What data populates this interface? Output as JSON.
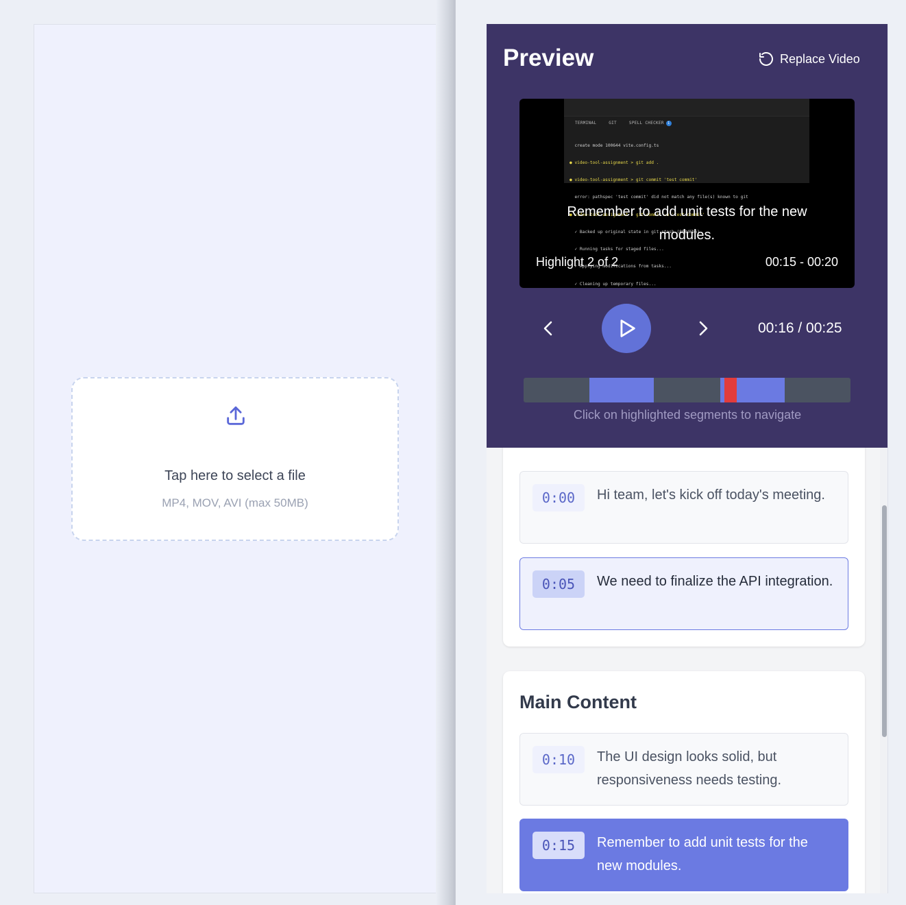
{
  "upload": {
    "title": "Tap here to select a file",
    "subtitle": "MP4, MOV, AVI (max 50MB)",
    "icon": "upload-icon"
  },
  "preview": {
    "title": "Preview",
    "replace_label": "Replace Video",
    "video": {
      "terminal_tabs": [
        "TERMINAL",
        "GIT",
        "SPELL CHECKER"
      ],
      "terminal_badge": "1",
      "terminal_lines": [
        "  create mode 100644 vite.config.ts",
        "● video-tool-assignment > git add .",
        "● video-tool-assignment > git commit 'test commit'",
        "  error: pathspec 'test commit' did not match any file(s) known to git",
        "● video-tool-assignment > git commit -m 'test commit'",
        "  ✓ Backed up original state in git stash (808d6b6)",
        "  ✓ Running tasks for staged files...",
        "  ✓ Applying modifications from tasks...",
        "  ✓ Cleaning up temporary files..."
      ],
      "caption": "Remember to add unit tests for the new modules.",
      "highlight_label": "Highlight 2 of 2",
      "highlight_range": "00:15 - 00:20"
    },
    "time_readout": "00:16 / 00:25",
    "timeline_hint": "Click on highlighted segments to navigate",
    "timeline": {
      "duration": 25,
      "current": 16,
      "highlights": [
        [
          5,
          10
        ],
        [
          15,
          20
        ]
      ]
    },
    "colors": {
      "panel": "#3d3466",
      "accent": "#6b7ae2",
      "playhead": "#e23c3c"
    }
  },
  "transcript": {
    "first_section": {
      "items": [
        {
          "time": "0:00",
          "text": "Hi team, let's kick off today's meeting.",
          "state": "normal"
        },
        {
          "time": "0:05",
          "text": "We need to finalize the API integration.",
          "state": "active"
        }
      ]
    },
    "main_section": {
      "title": "Main Content",
      "items": [
        {
          "time": "0:10",
          "text": "The UI design looks solid, but responsiveness needs testing.",
          "state": "normal"
        },
        {
          "time": "0:15",
          "text": "Remember to add unit tests for the new modules.",
          "state": "current"
        }
      ]
    }
  }
}
